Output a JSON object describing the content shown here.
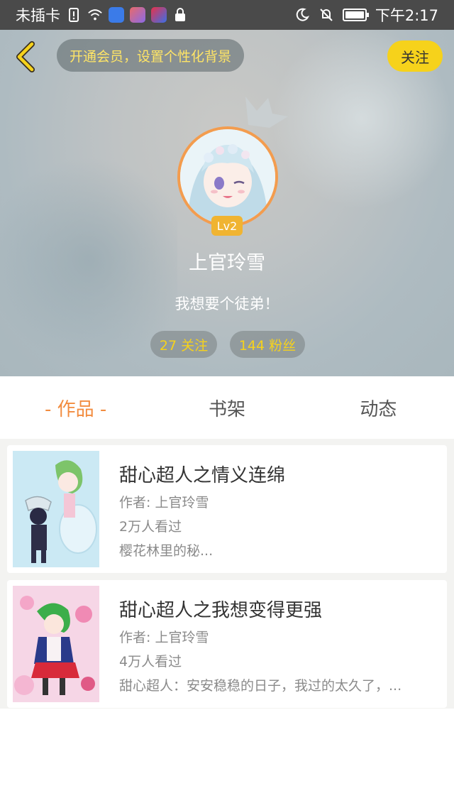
{
  "status_bar": {
    "carrier": "未插卡",
    "time": "下午2:17",
    "icons": [
      "sim-alert-icon",
      "wifi-icon",
      "baidu-app-icon",
      "app-icon",
      "video-app-icon",
      "lock-icon",
      "moon-icon",
      "mute-bell-icon",
      "battery-icon"
    ]
  },
  "header": {
    "vip_prompt": "开通会员，设置个性化背景",
    "follow_label": "关注",
    "level": "Lv2",
    "username": "上官玲雪",
    "bio": "我想要个徒弟！",
    "following": "27 关注",
    "fans": "144 粉丝"
  },
  "tabs": [
    {
      "label": "- 作品 -",
      "active": true
    },
    {
      "label": "书架",
      "active": false
    },
    {
      "label": "动态",
      "active": false
    }
  ],
  "works": [
    {
      "title": "甜心超人之情义连绵",
      "author": "作者: 上官玲雪",
      "views": "2万人看过",
      "desc": "樱花林里的秘..."
    },
    {
      "title": "甜心超人之我想变得更强",
      "author": "作者: 上官玲雪",
      "views": "4万人看过",
      "desc": "甜心超人：安安稳稳的日子，我过的太久了，..."
    }
  ],
  "colors": {
    "accent_orange": "#f28c3f",
    "accent_yellow": "#f6d21b",
    "status_bar": "#4a4a4a"
  }
}
